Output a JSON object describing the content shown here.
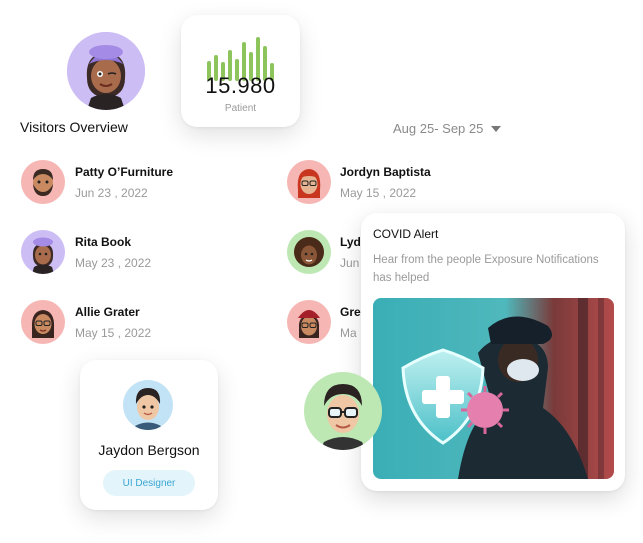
{
  "patient_stat": {
    "count": "15.980",
    "label": "Patient",
    "spark_values": [
      0.42,
      0.55,
      0.4,
      0.65,
      0.45,
      0.82,
      0.6,
      0.92,
      0.72,
      0.38
    ]
  },
  "overview": {
    "title": "Visitors Overview",
    "date_range": "Aug 25- Sep 25"
  },
  "visitors": [
    {
      "name": "Patty O’Furniture",
      "date": "Jun 23 , 2022",
      "avatar_icon": "memoji-bearded-man-icon"
    },
    {
      "name": "Rita Book",
      "date": "May 23 , 2022",
      "avatar_icon": "memoji-woman-purple-hat-icon"
    },
    {
      "name": "Allie Grater",
      "date": "May 15 , 2022",
      "avatar_icon": "memoji-woman-glasses-icon"
    },
    {
      "name": "Jordyn Baptista",
      "date": "May 15 , 2022",
      "avatar_icon": "memoji-redhead-woman-icon"
    },
    {
      "name": "Lyd",
      "date": "Jun",
      "avatar_icon": "memoji-curly-woman-icon"
    },
    {
      "name": "Gre",
      "date": "Ma",
      "avatar_icon": "memoji-woman-red-beanie-icon"
    }
  ],
  "profile": {
    "name": "Jaydon Bergson",
    "role": "UI Designer",
    "avatar_icon": "memoji-boy-icon"
  },
  "covid_alert": {
    "title": "COVID Alert",
    "body": "Hear from the people Exposure Notifications has helped",
    "image_icon": "masked-man-shield-virus-illustration"
  },
  "floating_avatars": [
    {
      "avatar_icon": "memoji-woman-winking-purple-hat-icon"
    },
    {
      "avatar_icon": "memoji-man-glasses-icon"
    }
  ],
  "colors": {
    "accent_green": "#8dc45c",
    "pill_bg": "#e3f4fb",
    "pill_text": "#3aa6d4",
    "muted_text": "#9a9a9a"
  }
}
